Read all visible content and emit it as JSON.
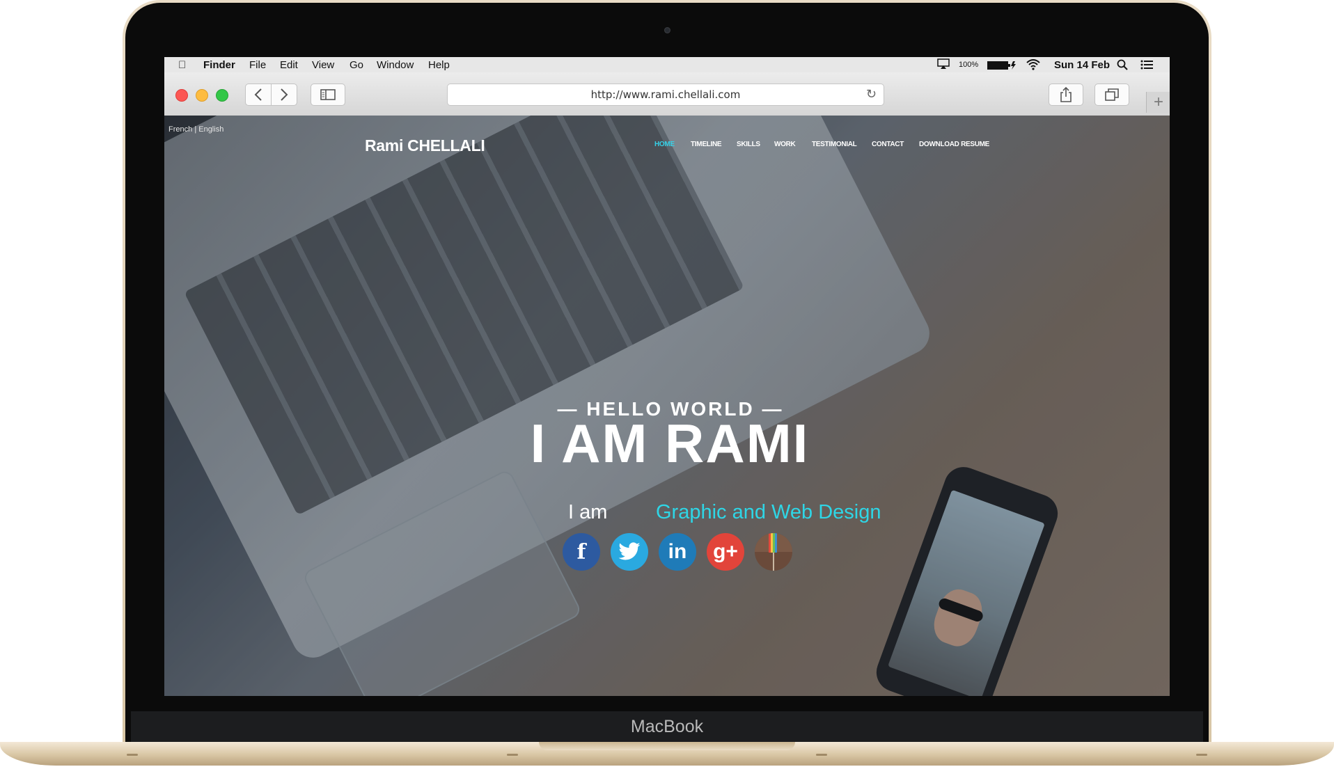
{
  "device": {
    "label": "MacBook"
  },
  "menubar": {
    "app": "Finder",
    "items": [
      "File",
      "Edit",
      "View",
      "Go",
      "Window",
      "Help"
    ],
    "battery": "100%",
    "datetime": "Sun 14 Feb"
  },
  "browser": {
    "url": "http://www.rami.chellali.com"
  },
  "site": {
    "language": {
      "french": "French",
      "separator": "|",
      "english": "English"
    },
    "brand": "Rami CHELLALI",
    "nav": [
      "HOME",
      "TIMELINE",
      "SKILLS",
      "WORK",
      "TESTIMONIAL",
      "CONTACT",
      "DOWNLOAD RESUME"
    ],
    "active_nav": "HOME",
    "hero": {
      "eyebrow": "— HELLO WORLD —",
      "headline": "I AM RAMI",
      "prefix": "I am",
      "role": "Graphic and Web Design"
    },
    "social": [
      {
        "name": "facebook",
        "glyph": "f",
        "color": "#2d5aa0"
      },
      {
        "name": "twitter",
        "glyph": "t",
        "color": "#2aa9e0"
      },
      {
        "name": "linkedin",
        "glyph": "in",
        "color": "#1f7bb8"
      },
      {
        "name": "google-plus",
        "glyph": "g+",
        "color": "#e2443a"
      },
      {
        "name": "instagram",
        "glyph": "",
        "color": "#6a4a3a"
      }
    ],
    "accent": "#36d0e6"
  }
}
